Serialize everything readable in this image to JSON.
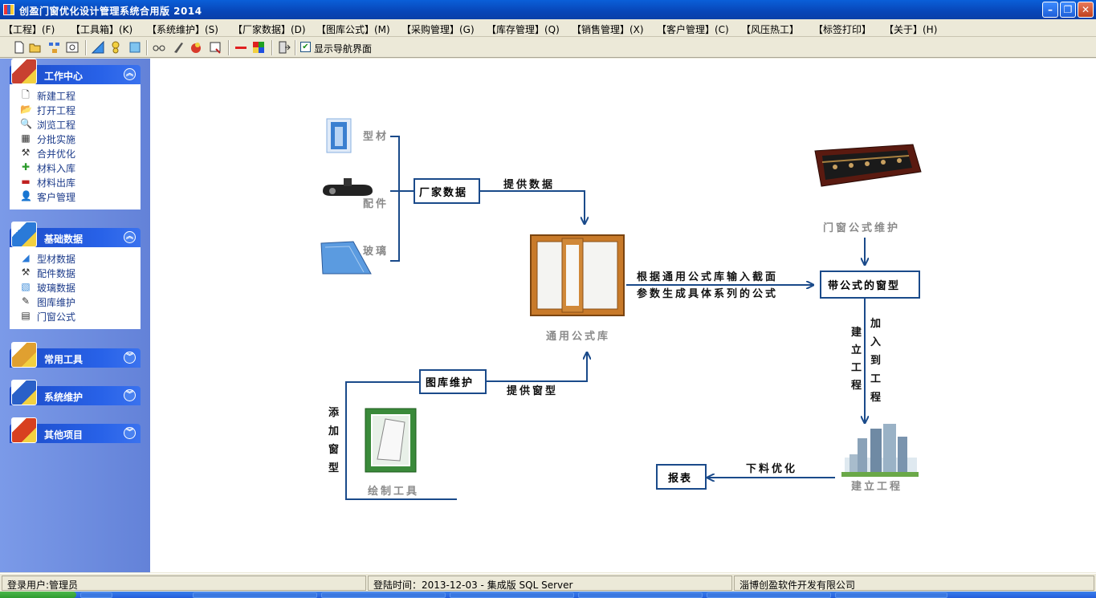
{
  "window": {
    "title": "创盈门窗优化设计管理系统合用版 2014"
  },
  "menu": [
    "【工程】(F)",
    "【工具箱】(K)",
    "【系统维护】(S)",
    "【厂家数据】(D)",
    "【图库公式】(M)",
    "【采购管理】(G)",
    "【库存管理】(Q)",
    "【销售管理】(X)",
    "【客户管理】(C)",
    "【风压热工】",
    "【标签打印】",
    "【关于】(H)"
  ],
  "toolbar": {
    "nav_checkbox_label": "显示导航界面",
    "nav_checked": true
  },
  "sidebar": {
    "groups": [
      {
        "title": "工作中心",
        "expanded": true,
        "icon": "briefcase-icon",
        "items": [
          {
            "label": "新建工程",
            "icon": "new-file-icon"
          },
          {
            "label": "打开工程",
            "icon": "open-folder-icon"
          },
          {
            "label": "浏览工程",
            "icon": "magnifier-icon"
          },
          {
            "label": "分批实施",
            "icon": "calendar-grid-icon"
          },
          {
            "label": "合并优化",
            "icon": "tools-icon"
          },
          {
            "label": "材料入库",
            "icon": "plus-icon"
          },
          {
            "label": "材料出库",
            "icon": "minus-icon"
          },
          {
            "label": "客户管理",
            "icon": "customer-icon"
          }
        ]
      },
      {
        "title": "基础数据",
        "expanded": true,
        "icon": "profile-data-icon",
        "items": [
          {
            "label": "型材数据",
            "icon": "profile-icon"
          },
          {
            "label": "配件数据",
            "icon": "tools-icon"
          },
          {
            "label": "玻璃数据",
            "icon": "glass-icon"
          },
          {
            "label": "图库维护",
            "icon": "pen-icon"
          },
          {
            "label": "门窗公式",
            "icon": "formula-icon"
          }
        ]
      },
      {
        "title": "常用工具",
        "expanded": false,
        "icon": "toolkit-icon",
        "items": []
      },
      {
        "title": "系统维护",
        "expanded": false,
        "icon": "grid-icon",
        "items": []
      },
      {
        "title": "其他项目",
        "expanded": false,
        "icon": "blocks-icon",
        "items": []
      }
    ]
  },
  "flow": {
    "inputs": {
      "profile": "型材",
      "hardware": "配件",
      "glass": "玻璃"
    },
    "vendor_data": "厂家数据",
    "provide_data": "提供数据",
    "formula_library": "通用公式库",
    "gen_line1": "根据通用公式库输入截面",
    "gen_line2": "参数生成具体系列的公式",
    "window_with_formula": "带公式的窗型",
    "formula_maintenance": "门窗公式维护",
    "build_project_v": "建立工程",
    "add_to_project_v": "加入到工程",
    "build_project": "建立工程",
    "cutting_optimize": "下料优化",
    "report": "报表",
    "library_maintenance": "图库维护",
    "provide_window": "提供窗型",
    "add_window_v": "添加窗型",
    "draw_tool": "绘制工具"
  },
  "status": {
    "user": "登录用户:管理员",
    "login": "登陆时间：2013-12-03  - 集成版 SQL Server",
    "company": "淄博创盈软件开发有限公司"
  }
}
